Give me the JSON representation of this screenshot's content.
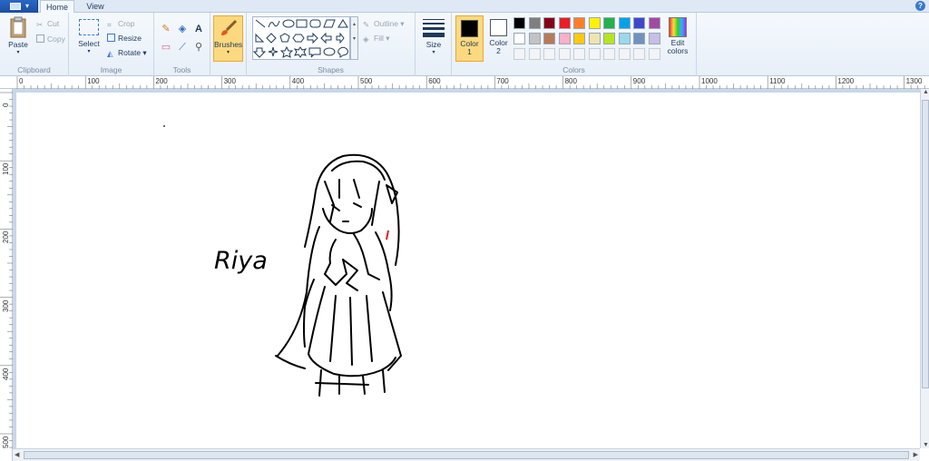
{
  "tabs": {
    "home": "Home",
    "view": "View"
  },
  "clipboard": {
    "paste": "Paste",
    "cut": "Cut",
    "copy": "Copy",
    "label": "Clipboard"
  },
  "image": {
    "select": "Select",
    "crop": "Crop",
    "resize": "Resize",
    "rotate": "Rotate",
    "label": "Image"
  },
  "tools": {
    "label": "Tools",
    "text_tool": "A"
  },
  "brushes": {
    "label": "Brushes"
  },
  "shapes": {
    "outline": "Outline",
    "fill": "Fill",
    "label": "Shapes"
  },
  "size": {
    "label": "Size"
  },
  "colors": {
    "color1": "Color",
    "color1_num": "1",
    "color2": "Color",
    "color2_num": "2",
    "edit": "Edit",
    "edit2": "colors",
    "label": "Colors",
    "row1": [
      "#000000",
      "#7f7f7f",
      "#880015",
      "#ed1c24",
      "#ff7f27",
      "#fff200",
      "#22b14c",
      "#00a2e8",
      "#3f48cc",
      "#a349a4"
    ],
    "row2": [
      "#ffffff",
      "#c3c3c3",
      "#b97a57",
      "#ffaec9",
      "#ffc90e",
      "#efe4b0",
      "#b5e61d",
      "#99d9ea",
      "#7092be",
      "#c8bfe7"
    ],
    "color1_value": "#000000",
    "color2_value": "#ffffff"
  },
  "ruler": {
    "top": [
      "0",
      "100",
      "200",
      "300",
      "400",
      "500",
      "600",
      "700",
      "800",
      "900",
      "1000",
      "1100",
      "1200",
      "1300"
    ],
    "left": [
      "0",
      "100",
      "200",
      "300",
      "400",
      "500"
    ]
  },
  "canvas": {
    "handwritten_text": "Riya"
  }
}
